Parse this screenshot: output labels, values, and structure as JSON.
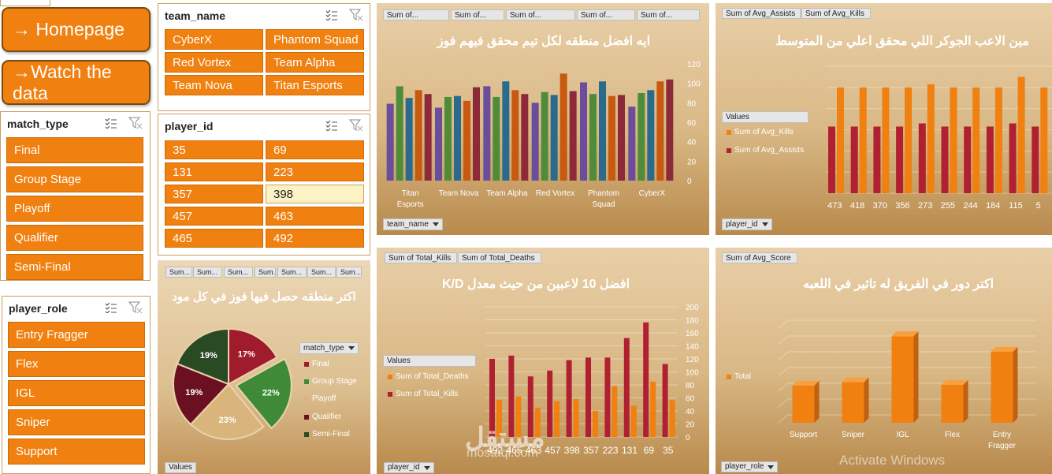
{
  "nav": {
    "homepage": "→ Homepage",
    "watch": "→Watch the data"
  },
  "slicers": {
    "team_name": {
      "title": "team_name",
      "items": [
        "CyberX",
        "Phantom Squad",
        "Red Vortex",
        "Team Alpha",
        "Team Nova",
        "Titan Esports"
      ]
    },
    "match_type": {
      "title": "match_type",
      "items": [
        "Final",
        "Group Stage",
        "Playoff",
        "Qualifier",
        "Semi-Final"
      ]
    },
    "player_id": {
      "title": "player_id",
      "items": [
        "35",
        "69",
        "131",
        "223",
        "357",
        "398",
        "457",
        "463",
        "465",
        "492"
      ],
      "selected": "398"
    },
    "player_role": {
      "title": "player_role",
      "items": [
        "Entry Fragger",
        "Flex",
        "IGL",
        "Sniper",
        "Support"
      ]
    }
  },
  "panel1": {
    "field_buttons": [
      "Sum of...",
      "Sum of...",
      "Sum of...",
      "Sum of...",
      "Sum of..."
    ],
    "title": "ايه افضل منطقه لكل تيم محقق فيهم فوز",
    "axis_dd": "team_name",
    "colors": [
      "#6b4e9b",
      "#4e8c3a",
      "#2a6a8c",
      "#c75a10",
      "#8c2a3a",
      "#4a78b0",
      "#e07a20"
    ],
    "chart_data": {
      "type": "bar",
      "categories": [
        "Titan Esports",
        "Team Nova",
        "Team Alpha",
        "Red Vortex",
        "Phantom Squad",
        "CyberX"
      ],
      "ylim": [
        0,
        120
      ],
      "yticks": [
        "0",
        "20",
        "40",
        "60",
        "80",
        "100",
        "120"
      ],
      "series": [
        {
          "values": [
            79,
            75,
            97,
            80,
            101,
            76
          ]
        },
        {
          "values": [
            97,
            86,
            86,
            91,
            89,
            90
          ]
        },
        {
          "values": [
            85,
            87,
            102,
            88,
            102,
            93
          ]
        },
        {
          "values": [
            93,
            82,
            93,
            110,
            87,
            102
          ]
        },
        {
          "values": [
            89,
            96,
            89,
            92,
            88,
            104
          ]
        },
        {
          "values": [
            0,
            0,
            0,
            0,
            0,
            0
          ]
        },
        {
          "values": [
            0,
            0,
            0,
            0,
            0,
            0
          ]
        }
      ]
    }
  },
  "panel2": {
    "field_buttons": [
      "Sum of Avg_Assists",
      "Sum of Avg_Kills"
    ],
    "title": "مين الاعب الجوكر اللي محقق اعلي من المتوسط",
    "legend_title": "Values",
    "legend": [
      {
        "label": "Sum of Avg_Kills",
        "color": "#f08010"
      },
      {
        "label": "Sum of Avg_Assists",
        "color": "#b02030"
      }
    ],
    "axis_dd": "player_id",
    "chart_data": {
      "type": "bar",
      "categories": [
        "473",
        "418",
        "370",
        "356",
        "273",
        "255",
        "244",
        "184",
        "115",
        "5"
      ],
      "series": [
        {
          "name": "Sum of Avg_Assists",
          "values": [
            6.3,
            6.3,
            6.3,
            6.3,
            6.6,
            6.3,
            6.3,
            6.3,
            6.6,
            6.3
          ]
        },
        {
          "name": "Sum of Avg_Kills",
          "values": [
            10.0,
            10.0,
            10.0,
            10.0,
            10.3,
            10.0,
            10.0,
            10.0,
            11.0,
            10.0
          ]
        }
      ]
    }
  },
  "panel3": {
    "field_buttons": [
      "Sum...",
      "Sum...",
      "Sum...",
      "Sum...",
      "Sum...",
      "Sum...",
      "Sum..."
    ],
    "title": "اكتر منطقه حصل فيها فوز في كل مود",
    "legend_title": "match_type",
    "legend": [
      {
        "label": "Final",
        "color": "#a01c2c"
      },
      {
        "label": "Group Stage",
        "color": "#3e8a36"
      },
      {
        "label": "Playoff",
        "color": "#d9b57c"
      },
      {
        "label": "Qualifier",
        "color": "#6a1020"
      },
      {
        "label": "Semi-Final",
        "color": "#2a4a24"
      }
    ],
    "values_btn": "Values",
    "chart_data": {
      "type": "pie",
      "categories": [
        "Final",
        "Group Stage",
        "Playoff",
        "Qualifier",
        "Semi-Final"
      ],
      "values": [
        17,
        22,
        23,
        19,
        19
      ],
      "labels": [
        "17%",
        "22%",
        "23%",
        "19%",
        "19%"
      ]
    }
  },
  "panel4": {
    "field_buttons": [
      "Sum of Total_Kills",
      "Sum of Total_Deaths"
    ],
    "title": "افضل 10 لاعبين من حيث معدل K/D",
    "legend_title": "Values",
    "legend": [
      {
        "label": "Sum of Total_Deaths",
        "color": "#f08010"
      },
      {
        "label": "Sum of Total_Kills",
        "color": "#b02030"
      }
    ],
    "axis_dd": "player_id",
    "chart_data": {
      "type": "bar",
      "categories": [
        "492",
        "465",
        "463",
        "457",
        "398",
        "357",
        "223",
        "131",
        "69",
        "35"
      ],
      "ylim": [
        0,
        200
      ],
      "yticks": [
        "0",
        "20",
        "40",
        "60",
        "80",
        "100",
        "120",
        "140",
        "160",
        "180",
        "200"
      ],
      "series": [
        {
          "name": "Sum of Total_Kills",
          "values": [
            120,
            125,
            93,
            102,
            118,
            122,
            122,
            152,
            176,
            112
          ]
        },
        {
          "name": "Sum of Total_Deaths",
          "values": [
            57,
            62,
            45,
            55,
            58,
            40,
            78,
            48,
            85,
            57
          ]
        }
      ]
    }
  },
  "panel5": {
    "field_buttons": [
      "Sum of Avg_Score"
    ],
    "title": "اكتر دور في الفريق له تاثير في اللعبه",
    "legend": [
      {
        "label": "Total",
        "color": "#f08010"
      }
    ],
    "axis_dd": "player_role",
    "chart_data": {
      "type": "bar",
      "categories": [
        "Support",
        "Sniper",
        "IGL",
        "Flex",
        "Entry Fragger"
      ],
      "series": [
        {
          "name": "Total",
          "values": [
            55,
            60,
            128,
            56,
            105
          ]
        }
      ]
    }
  },
  "watermark": "Activate Windows",
  "logo": {
    "arabic": "مستقل",
    "latin": "mostaql.com"
  }
}
